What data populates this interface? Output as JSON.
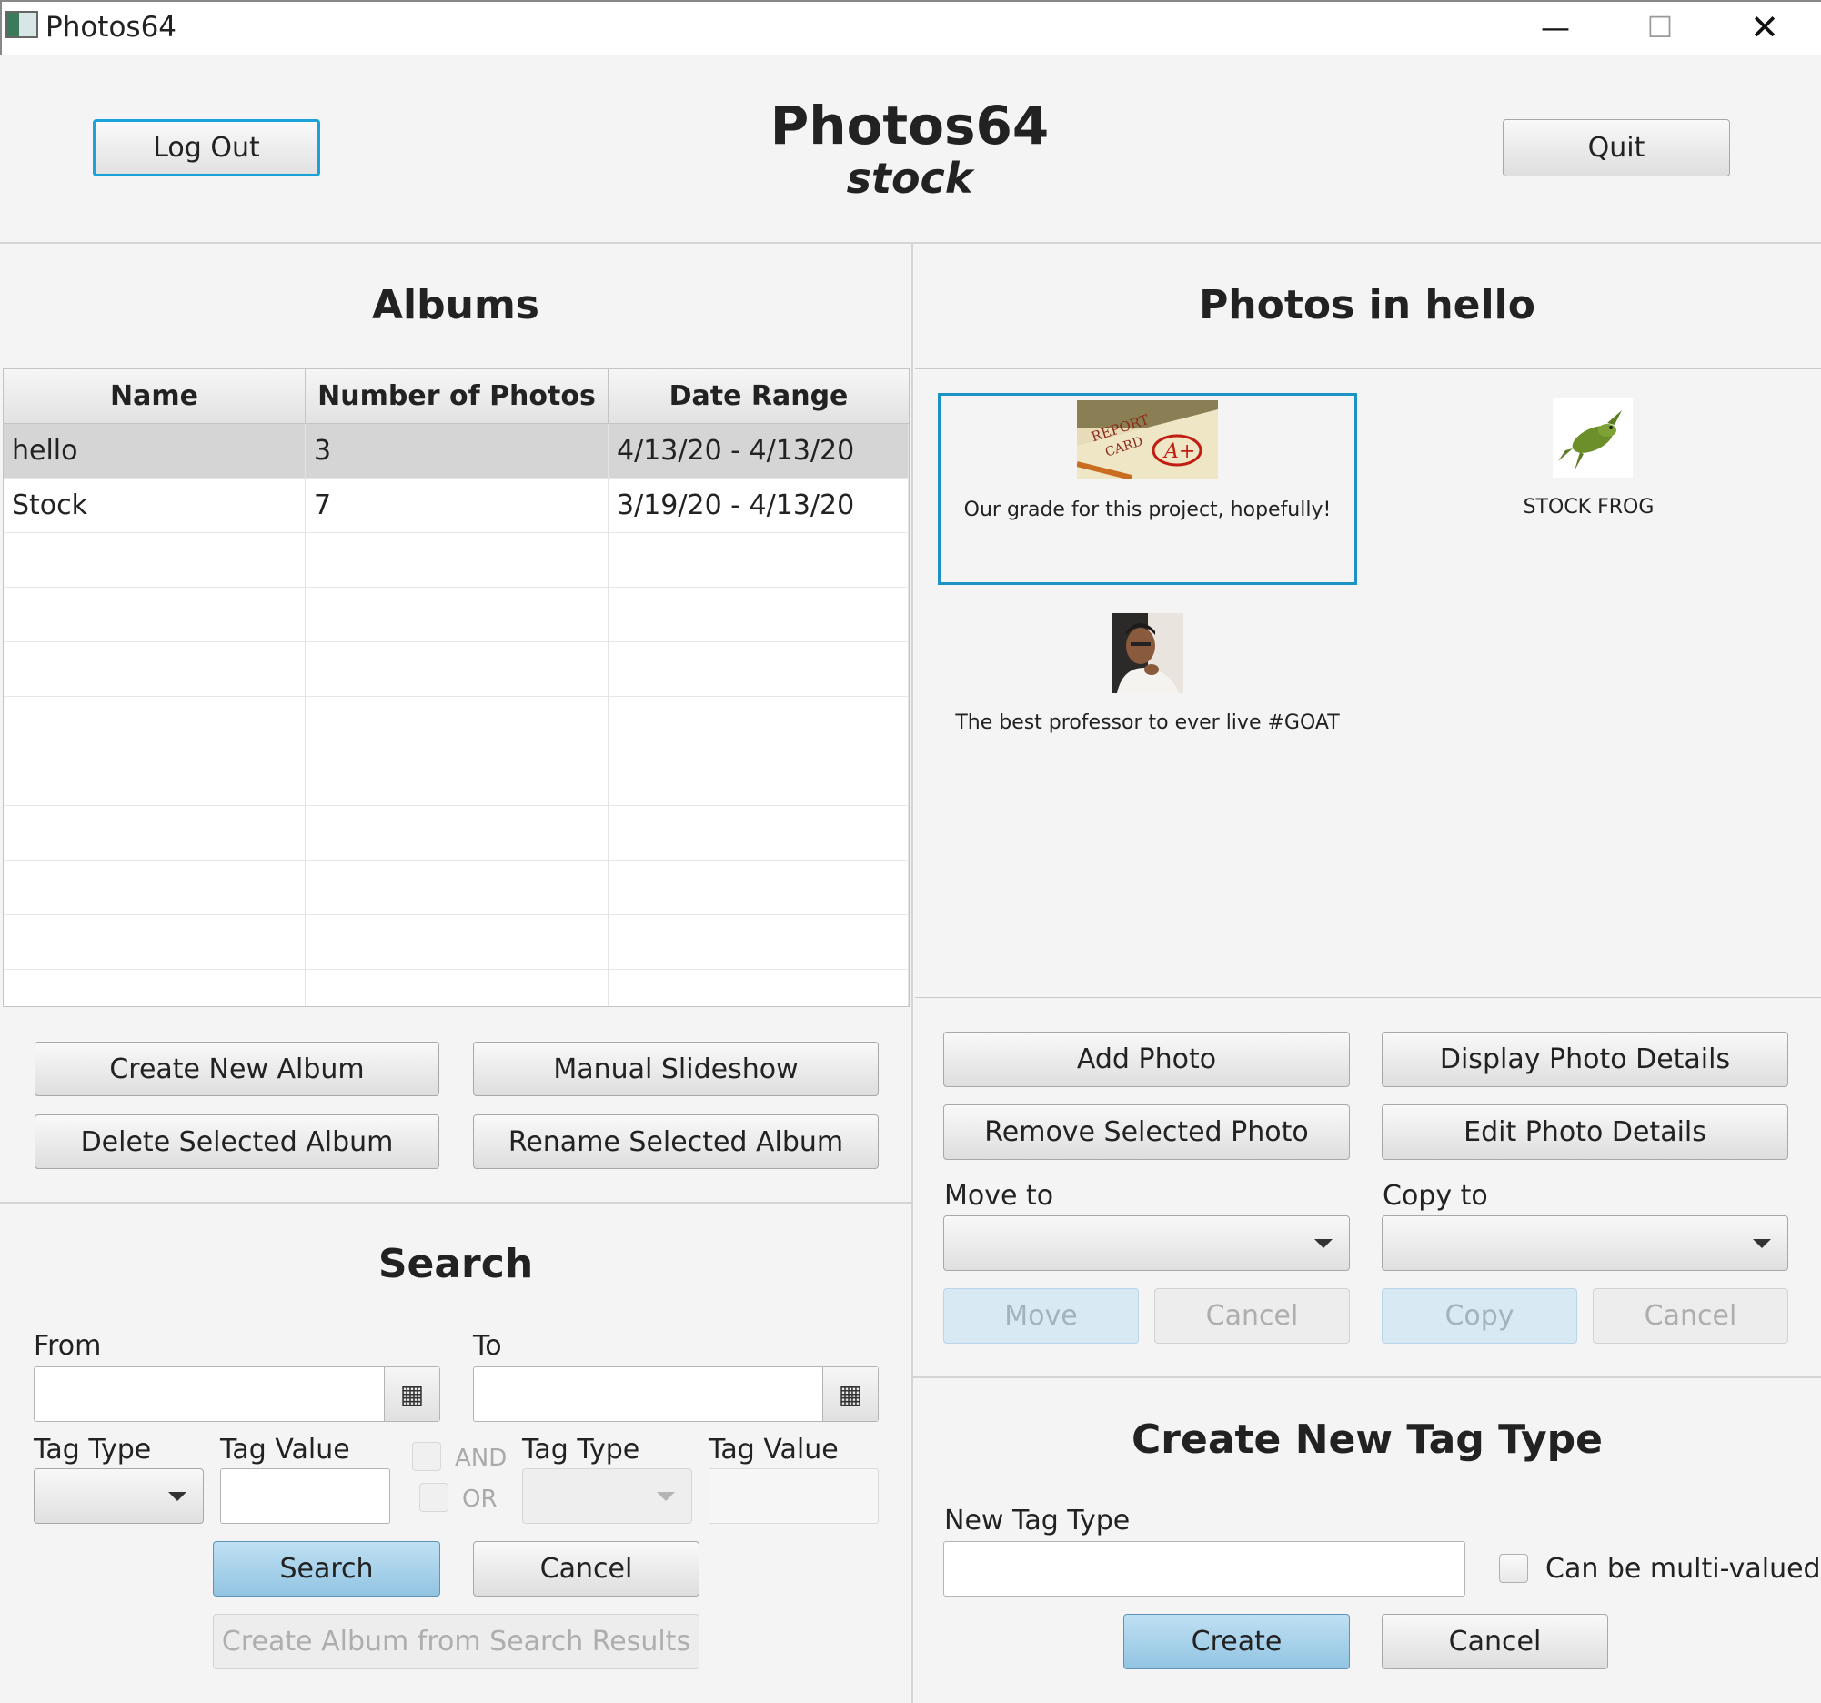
{
  "window": {
    "title": "Photos64",
    "controls": {
      "minimize": "—",
      "maximize": "☐",
      "close": "✕"
    }
  },
  "header": {
    "title": "Photos64",
    "username": "stock",
    "logout_label": "Log Out",
    "quit_label": "Quit"
  },
  "albums": {
    "title": "Albums",
    "columns": [
      "Name",
      "Number of Photos",
      "Date Range"
    ],
    "rows": [
      {
        "name": "hello",
        "count": "3",
        "range": "4/13/20 - 4/13/20"
      },
      {
        "name": "Stock",
        "count": "7",
        "range": "3/19/20 - 4/13/20"
      }
    ],
    "buttons": {
      "create": "Create New Album",
      "slideshow": "Manual Slideshow",
      "delete": "Delete Selected Album",
      "rename": "Rename Selected Album"
    }
  },
  "photos": {
    "title": "Photos in hello",
    "items": [
      {
        "caption": "Our grade for this project, hopefully!",
        "thumb": "report-card-thumbnail"
      },
      {
        "caption": "STOCK FROG",
        "thumb": "frog-thumbnail"
      },
      {
        "caption": "The best professor to ever live #GOAT",
        "thumb": "professor-thumbnail"
      }
    ],
    "buttons": {
      "add": "Add Photo",
      "display": "Display Photo Details",
      "remove": "Remove Selected Photo",
      "edit": "Edit Photo Details"
    },
    "move_label": "Move to",
    "copy_label": "Copy to",
    "move_btn": "Move",
    "move_cancel": "Cancel",
    "copy_btn": "Copy",
    "copy_cancel": "Cancel"
  },
  "search": {
    "title": "Search",
    "from_label": "From",
    "to_label": "To",
    "tag_type_label": "Tag Type",
    "tag_value_label": "Tag Value",
    "tag_type_label_2": "Tag Type",
    "tag_value_label_2": "Tag Value",
    "and_label": "AND",
    "or_label": "OR",
    "search_btn": "Search",
    "cancel_btn": "Cancel",
    "create_album_btn": "Create Album from Search Results",
    "calendar_icon": "▦"
  },
  "tag_type": {
    "title": "Create New Tag Type",
    "new_label": "New Tag Type",
    "multi_label": "Can be multi-valued",
    "create_btn": "Create",
    "cancel_btn": "Cancel"
  },
  "colors": {
    "focus_border": "#1aa3d8",
    "default_button": "#92c4e2",
    "selected_row": "#d5d5d5"
  }
}
